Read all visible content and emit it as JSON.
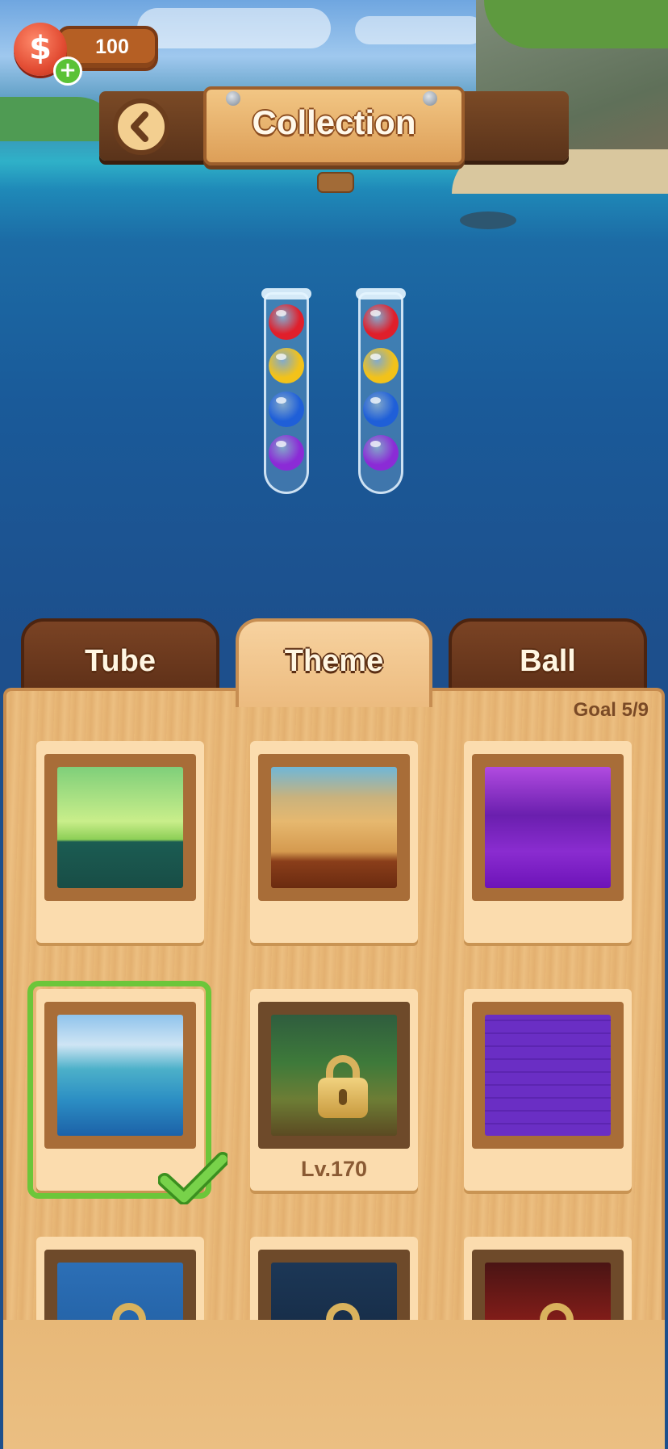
{
  "currency": {
    "value": "100",
    "icon": "dollar-coin-icon",
    "add_icon": "plus-icon"
  },
  "header": {
    "title": "Collection",
    "back_icon": "chevron-left-icon"
  },
  "preview": {
    "tubes": [
      {
        "balls": [
          "#e01f2b",
          "#f2c21a",
          "#1f5fd8",
          "#8b2bd6"
        ]
      },
      {
        "balls": [
          "#e01f2b",
          "#f2c21a",
          "#1f5fd8",
          "#8b2bd6"
        ]
      }
    ]
  },
  "tabs": [
    {
      "label": "Tube",
      "active": false
    },
    {
      "label": "Theme",
      "active": true
    },
    {
      "label": "Ball",
      "active": false
    }
  ],
  "goal": "Goal 5/9",
  "themes": [
    {
      "name": "forest",
      "locked": false,
      "selected": false
    },
    {
      "name": "desert",
      "locked": false,
      "selected": false
    },
    {
      "name": "purple-cave",
      "locked": false,
      "selected": false
    },
    {
      "name": "beach",
      "locked": false,
      "selected": true
    },
    {
      "name": "jungle-path",
      "locked": true,
      "level": "Lv.170",
      "selected": false
    },
    {
      "name": "purple-bricks",
      "locked": false,
      "selected": false
    },
    {
      "name": "ocean",
      "locked": true,
      "selected": false
    },
    {
      "name": "dark-forest",
      "locked": true,
      "selected": false
    },
    {
      "name": "volcano",
      "locked": true,
      "selected": false
    }
  ],
  "colors": {
    "selected_outline": "#6cc63a",
    "wood_dark": "#5d2f17",
    "wood_light": "#ecbb7f"
  }
}
